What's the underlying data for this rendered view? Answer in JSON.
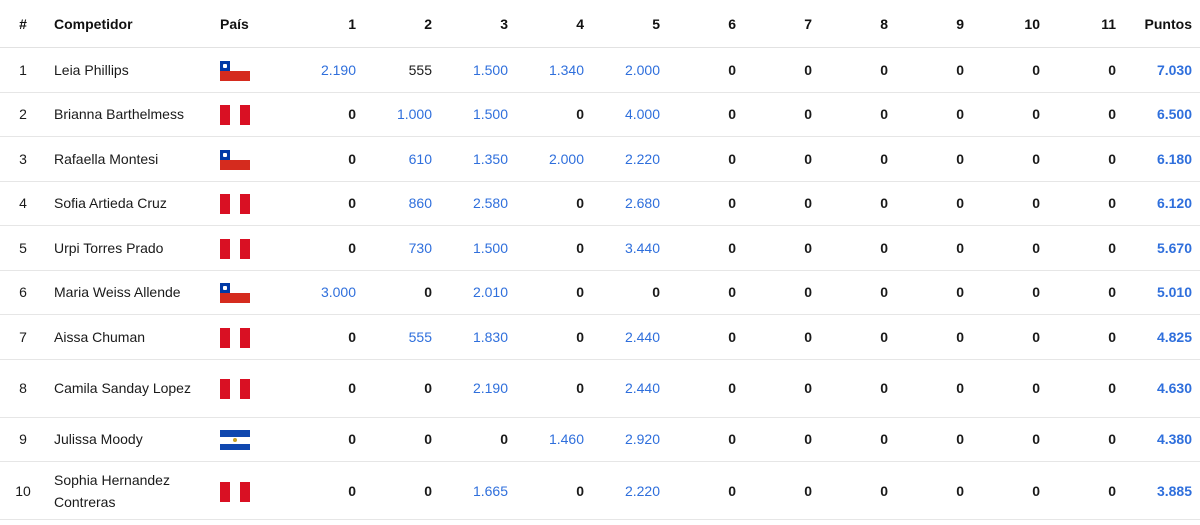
{
  "headers": {
    "rank": "#",
    "competitor": "Competidor",
    "country": "País",
    "events": [
      "1",
      "2",
      "3",
      "4",
      "5",
      "6",
      "7",
      "8",
      "9",
      "10",
      "11"
    ],
    "points": "Puntos"
  },
  "colors": {
    "link": "#2f6fdc",
    "text": "#1a1a1a"
  },
  "rows": [
    {
      "rank": "1",
      "name": "Leia Phillips",
      "country": "chile-flag-icon",
      "scores": [
        "2.190",
        "555",
        "1.500",
        "1.340",
        "2.000",
        "0",
        "0",
        "0",
        "0",
        "0",
        "0"
      ],
      "linked": [
        true,
        false,
        true,
        true,
        true,
        false,
        false,
        false,
        false,
        false,
        false
      ],
      "points": "7.030"
    },
    {
      "rank": "2",
      "name": "Brianna Barthelmess",
      "country": "peru-flag-icon",
      "scores": [
        "0",
        "1.000",
        "1.500",
        "0",
        "4.000",
        "0",
        "0",
        "0",
        "0",
        "0",
        "0"
      ],
      "linked": [
        false,
        true,
        true,
        false,
        true,
        false,
        false,
        false,
        false,
        false,
        false
      ],
      "points": "6.500"
    },
    {
      "rank": "3",
      "name": "Rafaella Montesi",
      "country": "chile-flag-icon",
      "scores": [
        "0",
        "610",
        "1.350",
        "2.000",
        "2.220",
        "0",
        "0",
        "0",
        "0",
        "0",
        "0"
      ],
      "linked": [
        false,
        true,
        true,
        true,
        true,
        false,
        false,
        false,
        false,
        false,
        false
      ],
      "points": "6.180"
    },
    {
      "rank": "4",
      "name": "Sofia Artieda Cruz",
      "country": "peru-flag-icon",
      "scores": [
        "0",
        "860",
        "2.580",
        "0",
        "2.680",
        "0",
        "0",
        "0",
        "0",
        "0",
        "0"
      ],
      "linked": [
        false,
        true,
        true,
        false,
        true,
        false,
        false,
        false,
        false,
        false,
        false
      ],
      "points": "6.120"
    },
    {
      "rank": "5",
      "name": "Urpi Torres Prado",
      "country": "peru-flag-icon",
      "scores": [
        "0",
        "730",
        "1.500",
        "0",
        "3.440",
        "0",
        "0",
        "0",
        "0",
        "0",
        "0"
      ],
      "linked": [
        false,
        true,
        true,
        false,
        true,
        false,
        false,
        false,
        false,
        false,
        false
      ],
      "points": "5.670"
    },
    {
      "rank": "6",
      "name": "Maria Weiss Allende",
      "country": "chile-flag-icon",
      "scores": [
        "3.000",
        "0",
        "2.010",
        "0",
        "0",
        "0",
        "0",
        "0",
        "0",
        "0",
        "0"
      ],
      "linked": [
        true,
        false,
        true,
        false,
        false,
        false,
        false,
        false,
        false,
        false,
        false
      ],
      "points": "5.010"
    },
    {
      "rank": "7",
      "name": "Aissa Chuman",
      "country": "peru-flag-icon",
      "scores": [
        "0",
        "555",
        "1.830",
        "0",
        "2.440",
        "0",
        "0",
        "0",
        "0",
        "0",
        "0"
      ],
      "linked": [
        false,
        true,
        true,
        false,
        true,
        false,
        false,
        false,
        false,
        false,
        false
      ],
      "points": "4.825"
    },
    {
      "rank": "8",
      "name": "Camila Sanday Lopez",
      "country": "peru-flag-icon",
      "scores": [
        "0",
        "0",
        "2.190",
        "0",
        "2.440",
        "0",
        "0",
        "0",
        "0",
        "0",
        "0"
      ],
      "linked": [
        false,
        false,
        true,
        false,
        true,
        false,
        false,
        false,
        false,
        false,
        false
      ],
      "points": "4.630"
    },
    {
      "rank": "9",
      "name": "Julissa Moody",
      "country": "el-salvador-flag-icon",
      "scores": [
        "0",
        "0",
        "0",
        "1.460",
        "2.920",
        "0",
        "0",
        "0",
        "0",
        "0",
        "0"
      ],
      "linked": [
        false,
        false,
        false,
        true,
        true,
        false,
        false,
        false,
        false,
        false,
        false
      ],
      "points": "4.380"
    },
    {
      "rank": "10",
      "name": "Sophia Hernandez Contreras",
      "country": "peru-flag-icon",
      "scores": [
        "0",
        "0",
        "1.665",
        "0",
        "2.220",
        "0",
        "0",
        "0",
        "0",
        "0",
        "0"
      ],
      "linked": [
        false,
        false,
        true,
        false,
        true,
        false,
        false,
        false,
        false,
        false,
        false
      ],
      "points": "3.885"
    }
  ]
}
